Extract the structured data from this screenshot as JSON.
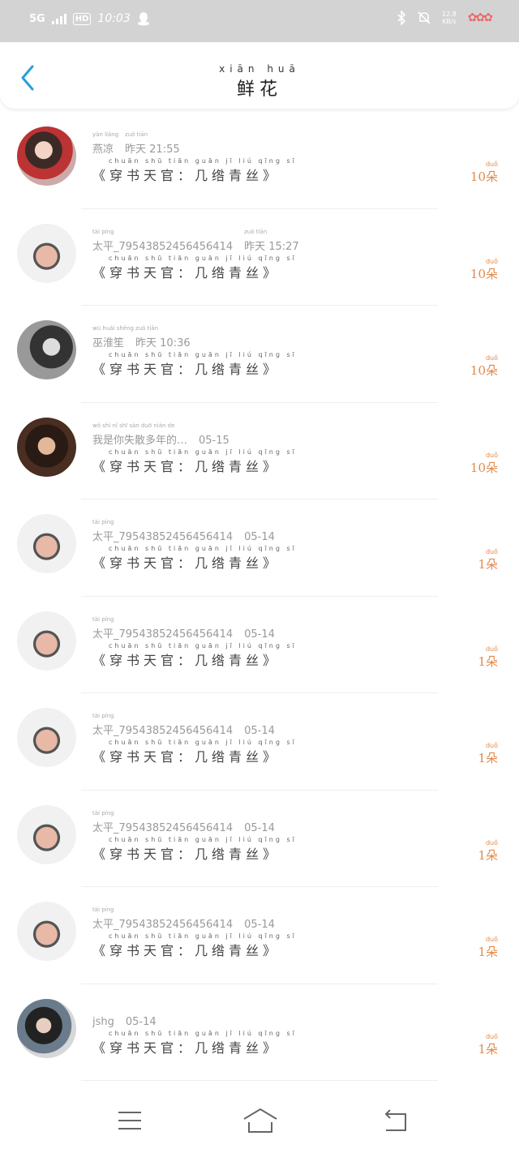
{
  "status": {
    "network": "5G",
    "hd": "HD",
    "time": "10:03",
    "speed_top": "12.8",
    "speed_bottom": "KB/s",
    "bluetooth_icon": "bluetooth-icon",
    "mute_icon": "bell-off-icon"
  },
  "header": {
    "title_pinyin": "xiān  huā",
    "title": "鲜花",
    "back_icon": "chevron-left-icon"
  },
  "list": [
    {
      "name_pinyin": "yàn  liáng",
      "name": "燕凉",
      "time_pinyin": "zuó  tiān",
      "time": "昨天 21:55",
      "book_pinyin": "chuān  shū  tiān  guān   jī  liú  qīng  sī",
      "book": "《穿书天官：几绺青丝》",
      "count_pinyin": "duǒ",
      "count": "10朵"
    },
    {
      "name_pinyin": "tài  píng",
      "name": "太平_7954385245645641​4",
      "time_pinyin": "zuó  tiān",
      "time": "昨天 15:27",
      "book_pinyin": "chuān  shū  tiān  guān   jī  liú  qīng  sī",
      "book": "《穿书天官：几绺青丝》",
      "count_pinyin": "duǒ",
      "count": "10朵"
    },
    {
      "name_pinyin": "wū  huái  shēng",
      "name": "巫淮笙",
      "time_pinyin": "zuó  tiān",
      "time": "昨天 10:36",
      "book_pinyin": "chuān  shū  tiān  guān   jī  liú  qīng  sī",
      "book": "《穿书天官：几绺青丝》",
      "count_pinyin": "duǒ",
      "count": "10朵"
    },
    {
      "name_pinyin": "wǒ shì nǐ shī sàn duō nián de",
      "name": "我是你失散多年的…",
      "time_pinyin": "",
      "time": "05-15",
      "book_pinyin": "chuān  shū  tiān  guān   jī  liú  qīng  sī",
      "book": "《穿书天官：几绺青丝》",
      "count_pinyin": "duǒ",
      "count": "10朵"
    },
    {
      "name_pinyin": "tài  píng",
      "name": "太平_79543852456456414",
      "time_pinyin": "",
      "time": "05-14",
      "book_pinyin": "chuān  shū  tiān  guān   jī  liú  qīng  sī",
      "book": "《穿书天官：几绺青丝》",
      "count_pinyin": "duǒ",
      "count": "1朵"
    },
    {
      "name_pinyin": "tài  píng",
      "name": "太平_79543852456456414",
      "time_pinyin": "",
      "time": "05-14",
      "book_pinyin": "chuān  shū  tiān  guān   jī  liú  qīng  sī",
      "book": "《穿书天官：几绺青丝》",
      "count_pinyin": "duǒ",
      "count": "1朵"
    },
    {
      "name_pinyin": "tài  píng",
      "name": "太平_79543852456456414",
      "time_pinyin": "",
      "time": "05-14",
      "book_pinyin": "chuān  shū  tiān  guān   jī  liú  qīng  sī",
      "book": "《穿书天官：几绺青丝》",
      "count_pinyin": "duǒ",
      "count": "1朵"
    },
    {
      "name_pinyin": "tài  píng",
      "name": "太平_79543852456456414",
      "time_pinyin": "",
      "time": "05-14",
      "book_pinyin": "chuān  shū  tiān  guān   jī  liú  qīng  sī",
      "book": "《穿书天官：几绺青丝》",
      "count_pinyin": "duǒ",
      "count": "1朵"
    },
    {
      "name_pinyin": "tài  píng",
      "name": "太平_79543852456456414",
      "time_pinyin": "",
      "time": "05-14",
      "book_pinyin": "chuān  shū  tiān  guān   jī  liú  qīng  sī",
      "book": "《穿书天官：几绺青丝》",
      "count_pinyin": "duǒ",
      "count": "1朵"
    },
    {
      "name_pinyin": "",
      "name": "jshg",
      "time_pinyin": "",
      "time": "05-14",
      "book_pinyin": "chuān  shū  tiān  guān   jī  liú  qīng  sī",
      "book": "《穿书天官：几绺青丝》",
      "count_pinyin": "duǒ",
      "count": "1朵"
    }
  ],
  "navbar": {
    "menu_icon": "menu-icon",
    "home_icon": "home-icon",
    "back_icon": "back-icon"
  },
  "colors": {
    "accent": "#2d9cdb",
    "count": "#e08a4a",
    "statusbar": "#d3d3d3"
  }
}
